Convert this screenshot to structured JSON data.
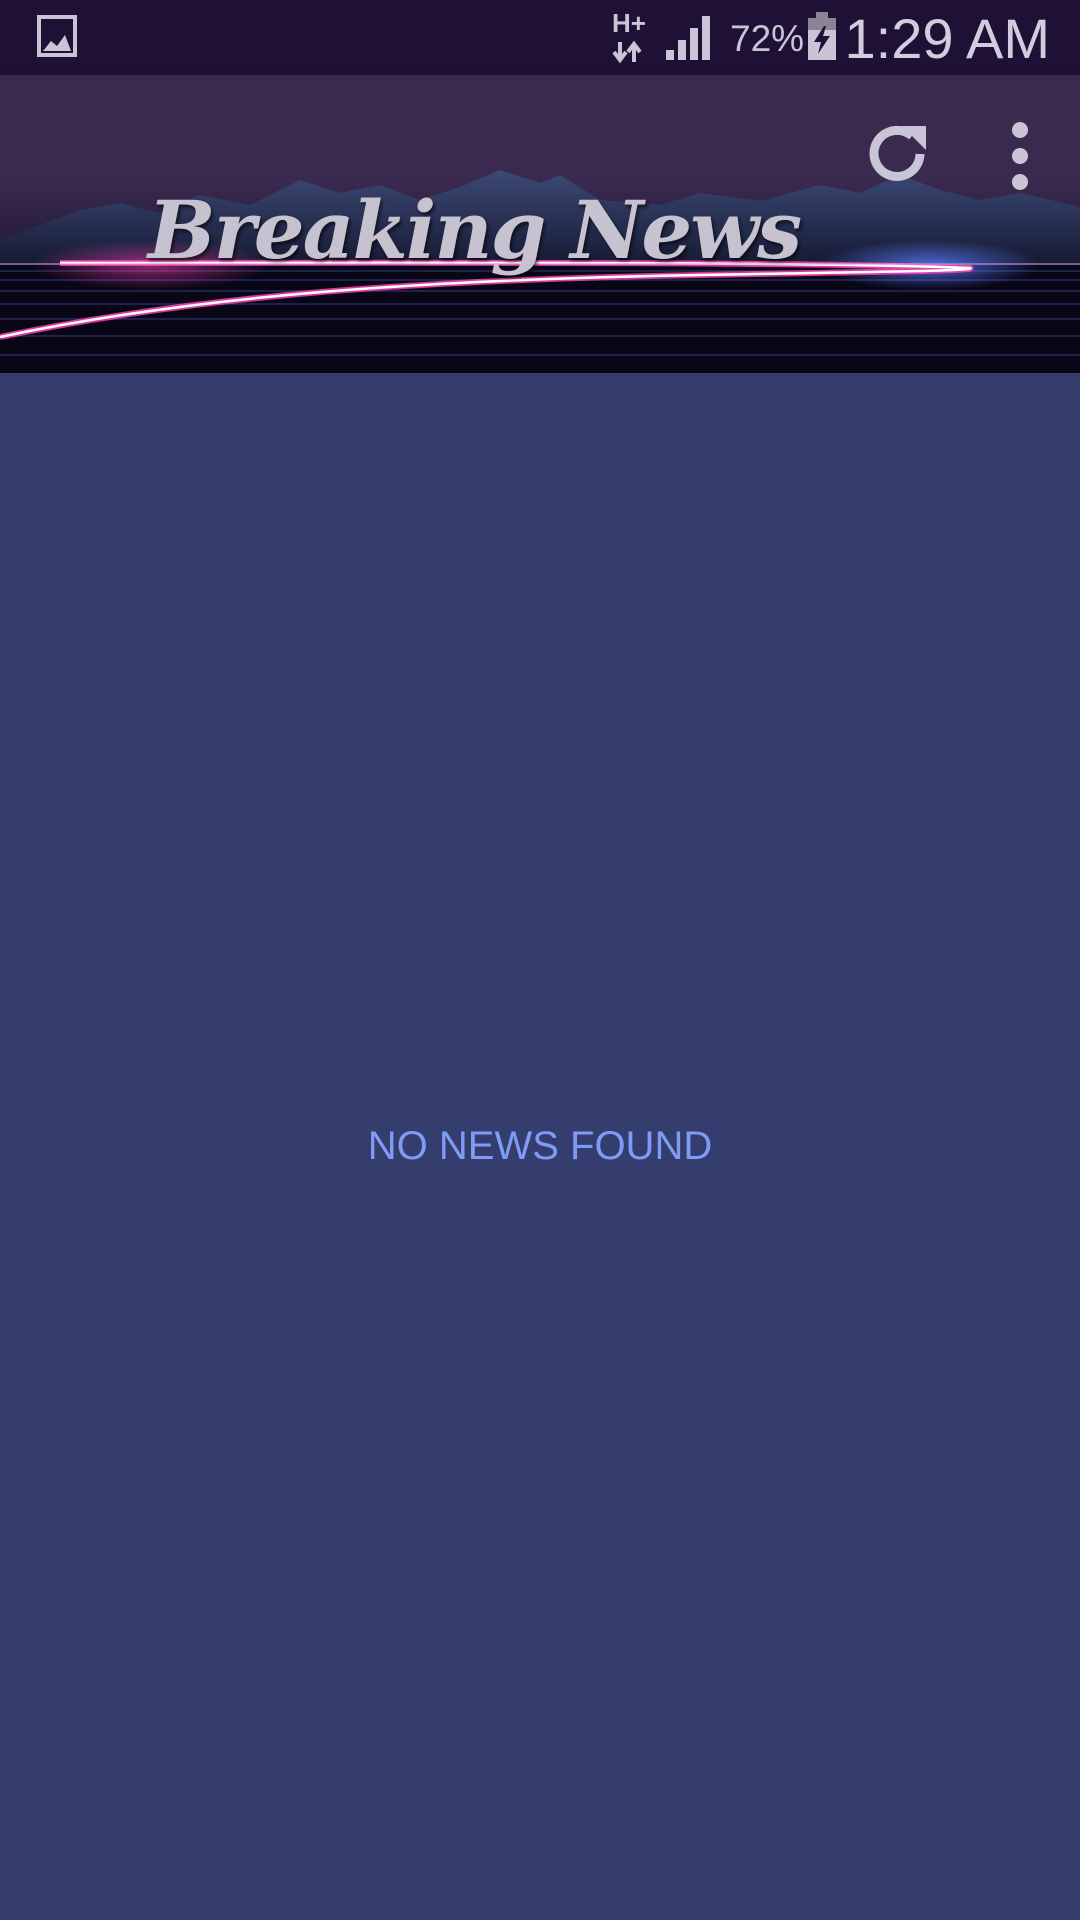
{
  "status_bar": {
    "network_type": "H+",
    "battery_percent": "72%",
    "time": "1:29 AM",
    "icons": [
      "gallery-icon",
      "data-transfer-icon",
      "signal-icon",
      "battery-charging-icon"
    ]
  },
  "app_bar": {
    "title": "Breaking News",
    "actions": [
      "refresh-icon",
      "more-vertical-icon"
    ]
  },
  "content": {
    "empty_message": "NO NEWS FOUND"
  },
  "colors": {
    "status_bar_bg": "#1f1135",
    "content_bg": "#353d6f",
    "empty_text": "#7f9cf5",
    "neon_pink": "#ff3fb0",
    "neon_blue": "#5a7cff"
  }
}
